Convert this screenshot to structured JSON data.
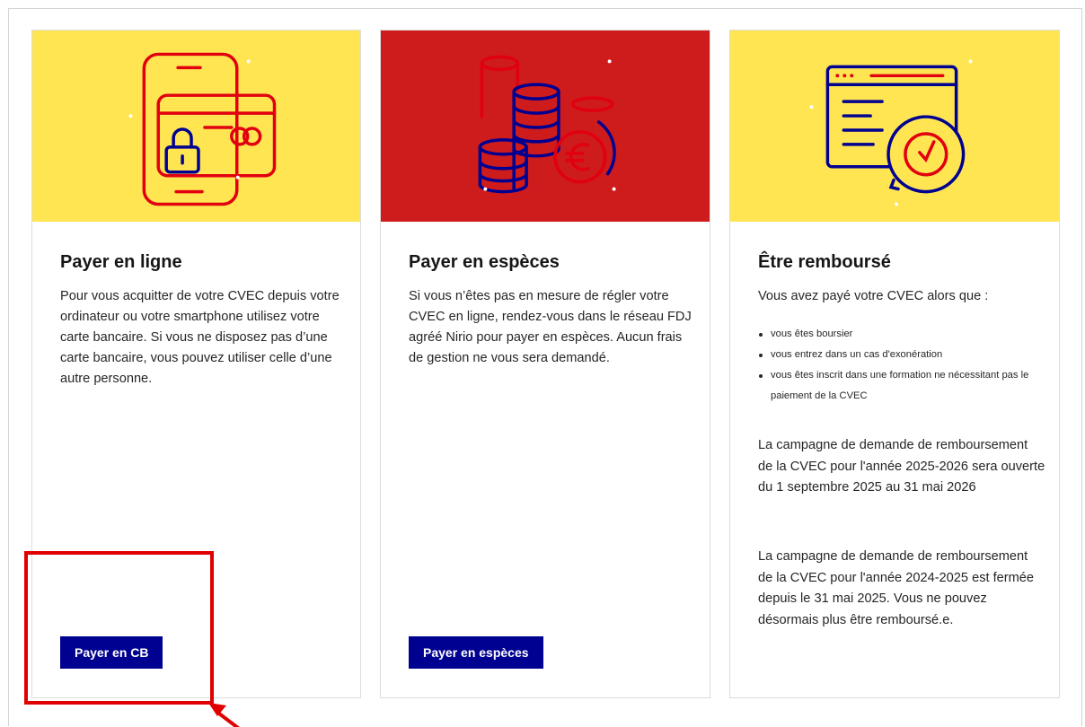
{
  "colors": {
    "accent_yellow": "#ffe552",
    "accent_red": "#ce1b1b",
    "button_blue": "#000091",
    "annotation_red": "#e00000"
  },
  "cards": [
    {
      "icon": "phone-card-lock-icon",
      "title": "Payer en ligne",
      "description": "Pour vous acquitter de votre CVEC depuis votre ordinateur ou votre smartphone utilisez votre carte bancaire. Si vous ne disposez pas d’une carte bancaire, vous pouvez utiliser celle d’une autre personne.",
      "button_label": "Payer en CB"
    },
    {
      "icon": "coins-euro-icon",
      "title": "Payer en espèces",
      "description": "Si vous n’êtes pas en mesure de régler votre CVEC en ligne, rendez-vous dans le réseau FDJ agréé Nirio pour payer en espèces. Aucun frais de gestion ne vous sera demandé.",
      "button_label": "Payer en espèces"
    },
    {
      "icon": "refund-clock-icon",
      "title": "Être remboursé",
      "intro": "Vous avez payé votre CVEC alors que :",
      "bullets": [
        "vous êtes boursier",
        "vous entrez dans un cas d'exonération",
        "vous êtes inscrit dans une formation ne nécessitant pas le paiement de la CVEC"
      ],
      "paragraph1": "La campagne de demande de remboursement de la CVEC pour l'année 2025-2026 sera ouverte du 1 septembre 2025 au 31 mai 2026",
      "paragraph2": "La campagne de demande de remboursement de la CVEC pour l'année 2024-2025 est fermée depuis le 31 mai 2025. Vous ne pouvez désormais plus être remboursé.e."
    }
  ]
}
